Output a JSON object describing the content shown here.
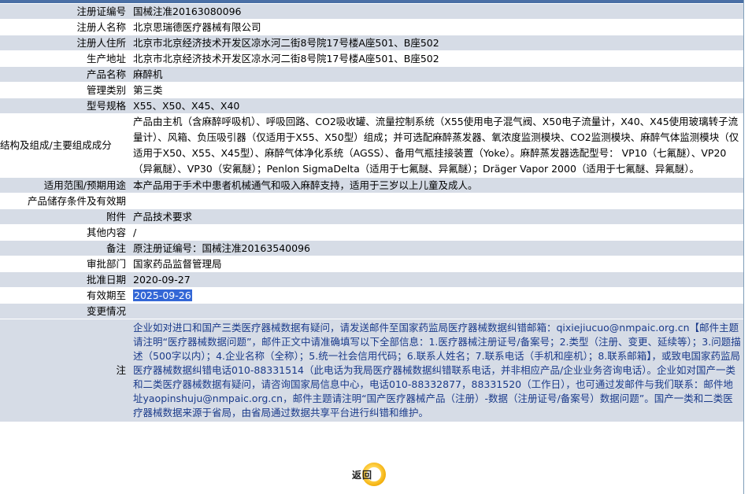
{
  "rows": [
    {
      "label": "注册证编号",
      "value": "国械注准20163080096"
    },
    {
      "label": "注册人名称",
      "value": "北京思瑞德医疗器械有限公司"
    },
    {
      "label": "注册人住所",
      "value": "北京市北京经济技术开发区凉水河二街8号院17号楼A座501、B座502"
    },
    {
      "label": "生产地址",
      "value": "北京市北京经济技术开发区凉水河二街8号院17号楼A座501、B座502"
    },
    {
      "label": "产品名称",
      "value": "麻醉机"
    },
    {
      "label": "管理类别",
      "value": "第三类"
    },
    {
      "label": "型号规格",
      "value": "X55、X50、X45、X40"
    },
    {
      "label": "结构及组成/主要组成成分",
      "value": "产品由主机（含麻醉呼吸机）、呼吸回路、CO2吸收罐、流量控制系统（X55使用电子混气阀、X50电子流量计，X40、X45使用玻璃转子流量计）、风箱、负压吸引器（仅适用于X55、X50型）组成；并可选配麻醉蒸发器、氧浓度监测模块、CO2监测模块、麻醉气体监测模块（仅适用于X50、X55、X45型）、麻醉气体净化系统（AGSS）、备用气瓶挂接装置（Yoke）。麻醉蒸发器选配型号： VP10（七氟醚）、VP20（异氟醚）、VP30（安氟醚）；Penlon SigmaDelta（适用于七氟醚、异氟醚）；Dräger Vapor 2000（适用于七氟醚、异氟醚）。"
    },
    {
      "label": "适用范围/预期用途",
      "value": "本产品用于手术中患者机械通气和吸入麻醉支持，适用于三岁以上儿童及成人。"
    },
    {
      "label": "产品储存条件及有效期",
      "value": ""
    },
    {
      "label": "附件",
      "value": "产品技术要求"
    },
    {
      "label": "其他内容",
      "value": "/"
    },
    {
      "label": "备注",
      "value": "原注册证编号：国械注准20163540096"
    },
    {
      "label": "审批部门",
      "value": "国家药品监督管理局"
    },
    {
      "label": "批准日期",
      "value": "2020-09-27"
    },
    {
      "label": "有效期至",
      "value": "2025-09-26"
    },
    {
      "label": "变更情况",
      "value": ""
    }
  ],
  "note": {
    "label": "注",
    "text": "企业如对进口和国产三类医疗器械数据有疑问，请发送邮件至国家药监局医疗器械数据纠错邮箱：qixiejiucuo@nmpaic.org.cn【邮件主题请注明“医疗器械数据问题”，邮件正文中请准确填写以下全部信息：1.医疗器械注册证号/备案号；2.类型（注册、变更、延续等）；3.问题描述（500字以内）；4.企业名称（全称）；5.统一社会信用代码；6.联系人姓名；7.联系电话（手机和座机）；8.联系邮箱】，或致电国家药监局医疗器械数据纠错电话010-88331514（此电话为我局医疗器械数据纠错联系电话，并非相应产品/企业业务咨询电话）。企业如对国产一类和二类医疗器械数据有疑问，请咨询国家局信息中心，电话010-88332877，88331520（工作日），也可通过发邮件与我们联系：邮件地址yaopinshuju@nmpaic.org.cn，邮件主题请注明“国产医疗器械产品（注册）-数据（注册证号/备案号）数据问题”。国产一类和二类医疗器械数据来源于省局，由省局通过数据共享平台进行纠错和维护。"
  },
  "back_button": {
    "label": "返回",
    "icon": "back-ring-icon"
  },
  "colors": {
    "row_shade": "#d6dce6",
    "selection": "#3367d6",
    "note_text": "#1a3a8a",
    "top_bar": "#4a6fa5"
  }
}
